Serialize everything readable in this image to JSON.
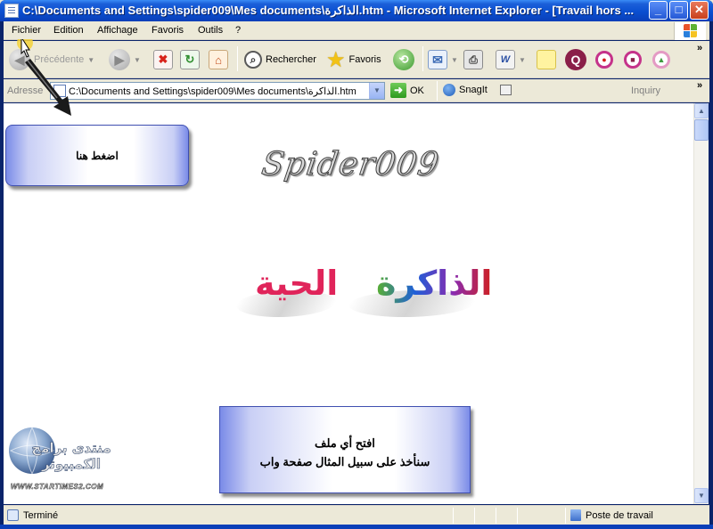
{
  "window": {
    "title": "C:\\Documents and Settings\\spider009\\Mes documents\\الذاكرة.htm - Microsoft Internet Explorer - [Travail hors ...",
    "minimize": "_",
    "maximize": "□",
    "close": "✕"
  },
  "menu": {
    "items": [
      "Fichier",
      "Edition",
      "Affichage",
      "Favoris",
      "Outils",
      "?"
    ]
  },
  "toolbar": {
    "back_label": "Précédente",
    "search_label": "Rechercher",
    "favorites_label": "Favoris",
    "expand": "»"
  },
  "address": {
    "label": "Adresse",
    "value": "C:\\Documents and Settings\\spider009\\Mes documents\\الذاكرة.htm",
    "go_label": "OK",
    "snagit_label": "SnagIt",
    "inquiry_label": "Inquiry",
    "expand": "»"
  },
  "content": {
    "callout_top": "اضغط هنا",
    "logo": "Spider009",
    "wordart_right": "الذاكرة",
    "wordart_left": "الحية",
    "callout_bottom_line1": "افتح أي ملف",
    "callout_bottom_line2": "سنأخذ على سبيل المثال صفحة واب",
    "forum_logo_text": "منتدى برامج الكمبيوتر",
    "forum_logo_url": "WWW.STARTIMES2.COM"
  },
  "status": {
    "text": "Terminé",
    "zone": "Poste de travail"
  },
  "colors": {
    "title_bar": "#0A4FD0",
    "chrome": "#ECE9D8",
    "callout_border": "#3F4FB0"
  }
}
